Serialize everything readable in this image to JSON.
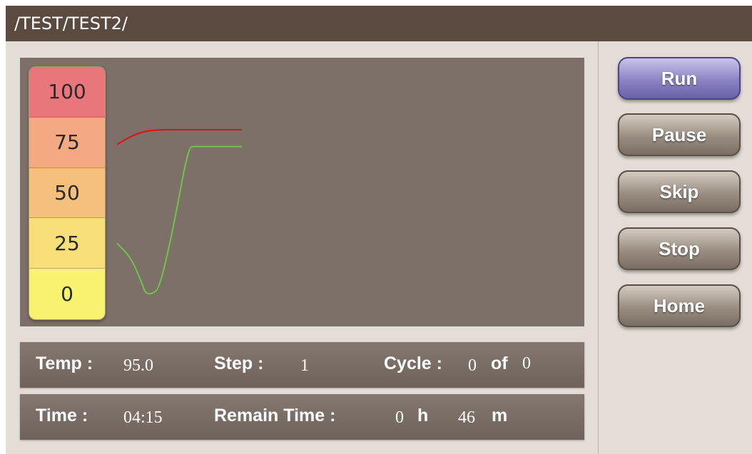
{
  "header": {
    "path": "/TEST/TEST2/"
  },
  "scale": {
    "labels": [
      "100",
      "75",
      "50",
      "25",
      "0"
    ],
    "colors": [
      "#e8767a",
      "#f3aa82",
      "#f5bf7e",
      "#f8df7a",
      "#f8f271"
    ]
  },
  "chart_data": {
    "type": "line",
    "ylim": [
      0,
      100
    ],
    "series": [
      {
        "color": "#e01010",
        "points": [
          [
            0,
            74
          ],
          [
            5,
            79
          ],
          [
            10,
            81
          ],
          [
            20,
            81
          ],
          [
            35,
            81
          ]
        ]
      },
      {
        "color": "#6ec34a",
        "points": [
          [
            0,
            27
          ],
          [
            4,
            20
          ],
          [
            7,
            8
          ],
          [
            8,
            3
          ],
          [
            10,
            3
          ],
          [
            12,
            6
          ],
          [
            16,
            36
          ],
          [
            20,
            73
          ],
          [
            22,
            73
          ],
          [
            35,
            73
          ]
        ]
      }
    ]
  },
  "status": {
    "temp_label": "Temp :",
    "temp_value": "95.0",
    "step_label": "Step :",
    "step_value": "1",
    "cycle_label": "Cycle :",
    "cycle_value": "0",
    "cycle_of": "of",
    "cycle_total": "0",
    "time_label": "Time :",
    "time_value": "04:15",
    "remain_label": "Remain Time :",
    "remain_hours": "0",
    "hours_unit": "h",
    "remain_minutes": "46",
    "minutes_unit": "m"
  },
  "buttons": {
    "run": "Run",
    "pause": "Pause",
    "skip": "Skip",
    "stop": "Stop",
    "home": "Home"
  }
}
